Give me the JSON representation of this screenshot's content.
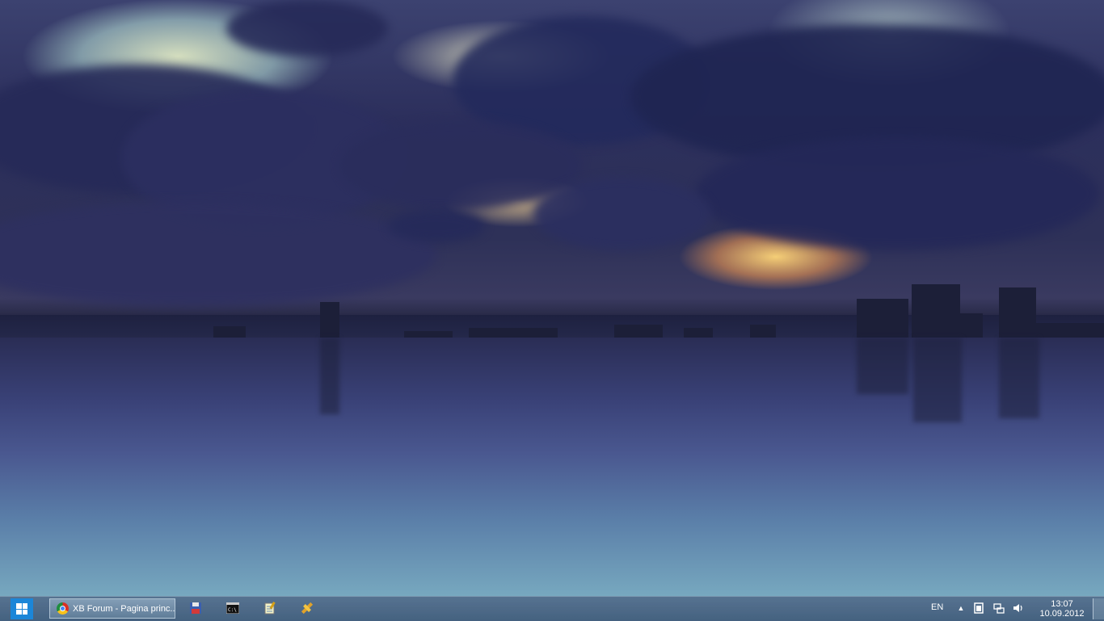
{
  "taskbar": {
    "start": {
      "icon": "windows-logo-icon"
    },
    "running_app": {
      "icon": "chrome-icon",
      "label": "XB Forum - Pagina princ..."
    },
    "pinned": [
      {
        "name": "save-floppy-icon"
      },
      {
        "name": "command-prompt-icon"
      },
      {
        "name": "notepad-icon"
      },
      {
        "name": "tools-icon"
      }
    ],
    "tray": {
      "language": "EN",
      "time": "13:07",
      "date": "10.09.2012"
    }
  },
  "colors": {
    "start_button": "#1b86d8",
    "taskbar": "#5a7896"
  }
}
